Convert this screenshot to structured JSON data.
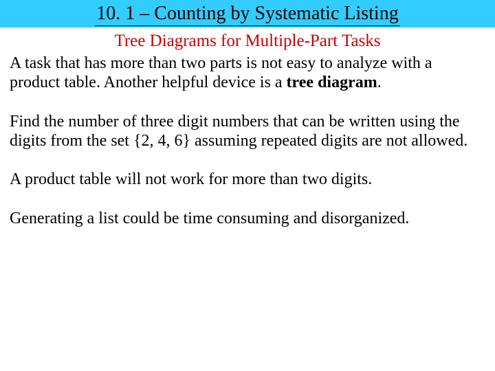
{
  "header": {
    "title": "10. 1 – Counting by Systematic Listing"
  },
  "subtitle": "Tree Diagrams for Multiple-Part Tasks",
  "paragraphs": {
    "p1_a": "A task that has more than two parts is not easy to analyze with a product table.  Another helpful device is a ",
    "p1_b": "tree diagram",
    "p1_c": ".",
    "p2": "Find the number of three digit numbers that can be written using the digits from the set {2, 4, 6} assuming repeated digits are not allowed.",
    "p3": "A product table will not work for more than two digits.",
    "p4": "Generating a list could be time consuming and disorganized."
  }
}
